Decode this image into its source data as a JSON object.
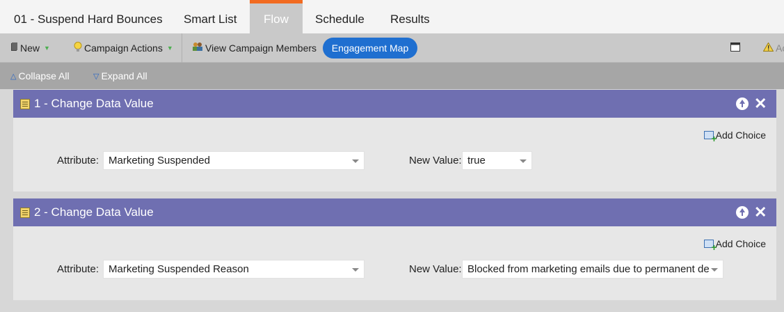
{
  "tabs": [
    {
      "label": "01 - Suspend Hard Bounces",
      "active": false
    },
    {
      "label": "Smart List",
      "active": false
    },
    {
      "label": "Flow",
      "active": true
    },
    {
      "label": "Schedule",
      "active": false
    },
    {
      "label": "Results",
      "active": false
    }
  ],
  "toolbar": {
    "new_label": "New",
    "campaign_actions_label": "Campaign Actions",
    "view_members_label": "View Campaign Members",
    "engagement_map_label": "Engagement Map",
    "truncated_label": "Ac"
  },
  "collapse_bar": {
    "collapse_label": "Collapse All",
    "expand_label": "Expand All"
  },
  "steps": [
    {
      "title": "1 - Change Data Value",
      "add_choice": "Add Choice",
      "attribute_label": "Attribute:",
      "attribute_value": "Marketing Suspended",
      "new_value_label": "New Value:",
      "new_value": "true"
    },
    {
      "title": "2 - Change Data Value",
      "add_choice": "Add Choice",
      "attribute_label": "Attribute:",
      "attribute_value": "Marketing Suspended Reason",
      "new_value_label": "New Value:",
      "new_value": "Blocked from marketing emails due to permanent de"
    }
  ],
  "colors": {
    "accent_tab": "#f26b21",
    "step_header": "#6f6fb1",
    "primary_button": "#1f6fd0"
  }
}
